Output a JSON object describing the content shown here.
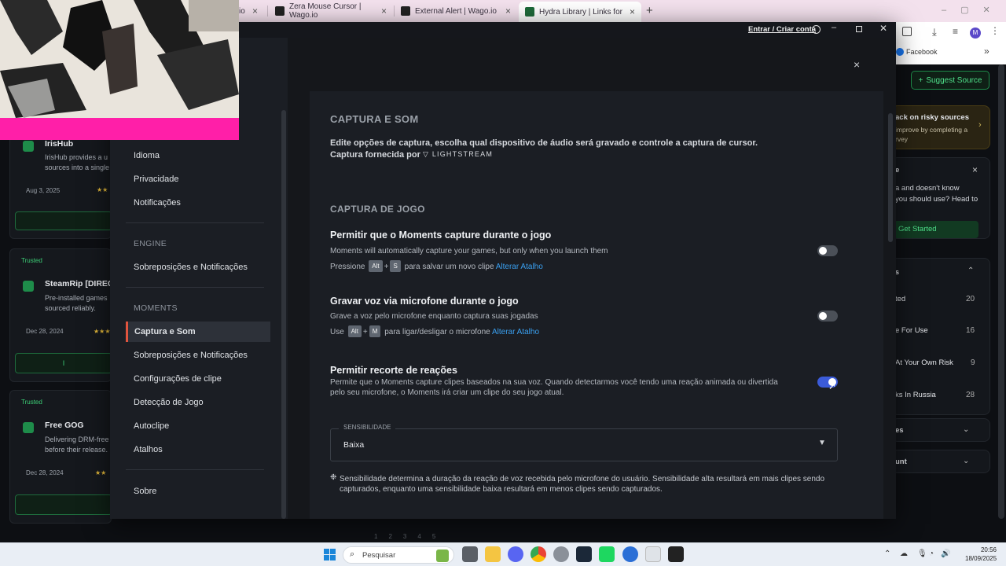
{
  "browser": {
    "tabs": [
      {
        "label": "Zera Mouse Cursor | Wago.io"
      },
      {
        "label": "External Alert | Wago.io"
      },
      {
        "label": "Hydra Library | Links for Hydra L"
      }
    ],
    "partial_tab": "io",
    "bookmark": "Facebook",
    "new_tab": "+",
    "profile_initial": "M"
  },
  "hydra_page": {
    "suggest_button": "Suggest Source",
    "suggest_prefix": "t",
    "risky": {
      "title": "ack on risky sources",
      "body": "improve by completing a\nrvey"
    },
    "help": {
      "title": "e",
      "body": "a and doesn't know\nyou should use? Head to",
      "button": "Get Started"
    },
    "filters": [
      {
        "label": "ted",
        "count": "20"
      },
      {
        "label": "e For Use",
        "count": "16"
      },
      {
        "label": "At Your Own Risk",
        "count": "9"
      },
      {
        "label": "ks In Russia",
        "count": "28"
      }
    ],
    "collapsed": [
      {
        "label": "es"
      },
      {
        "label": "unt"
      }
    ],
    "cards": [
      {
        "badge": "",
        "name": "IrisHub",
        "desc": "IrisHub provides a u\nsources into a single",
        "date": "Aug 3, 2025",
        "stars": "★★"
      },
      {
        "badge": "Trusted",
        "name": "SteamRip [DIREC",
        "desc": "Pre-installed games\nsourced reliably.",
        "date": "Dec 28, 2024",
        "stars": "★★★",
        "action": "I"
      },
      {
        "badge": "Trusted",
        "name": "Free GOG",
        "desc": "Delivering DRM-free\nbefore their release.",
        "date": "Dec 28, 2024",
        "stars": "★★"
      }
    ],
    "pagination": [
      "1",
      "2",
      "3",
      "4",
      "5"
    ]
  },
  "app": {
    "account_link": "Entrar / Criar conta",
    "sidebar": {
      "items_top": [
        "Idioma",
        "Privacidade",
        "Notificações"
      ],
      "engine_header": "ENGINE",
      "engine_items": [
        "Sobreposições e Notificações"
      ],
      "moments_header": "MOMENTS",
      "moments_items": [
        "Captura e Som",
        "Sobreposições e Notificações",
        "Configurações de clipe",
        "Detecção de Jogo",
        "Autoclipe",
        "Atalhos"
      ],
      "about": "Sobre"
    },
    "main": {
      "title": "CAPTURA E SOM",
      "intro": "Edite opções de captura, escolha qual dispositivo de áudio será gravado e controle a captura de cursor.",
      "provided_by": "Captura fornecida por",
      "provider": "LIGHTSTREAM",
      "section": "CAPTURA DE JOGO",
      "options": [
        {
          "title": "Permitir que o Moments capture durante o jogo",
          "desc": "Moments will automatically capture your games, but only when you launch them",
          "hint_pre": "Pressione",
          "key1": "Alt",
          "plus": "+",
          "key2": "S",
          "hint_post": "para salvar um novo clipe",
          "link": "Alterar Atalho",
          "enabled": false
        },
        {
          "title": "Gravar voz via microfone durante o jogo",
          "desc": "Grave a voz pelo microfone enquanto captura suas jogadas",
          "hint_pre": "Use",
          "key1": "Alt",
          "plus": "+",
          "key2": "M",
          "hint_post": "para ligar/desligar o microfone",
          "link": "Alterar Atalho",
          "enabled": false
        },
        {
          "title": "Permitir recorte de reações",
          "desc": "Permite que o Moments capture clipes baseados na sua voz. Quando detectarmos você tendo uma reação animada ou divertida pelo seu microfone, o Moments irá criar um clipe do seu jogo atual.",
          "enabled": true
        }
      ],
      "sensitivity_label": "SENSIBILIDADE",
      "sensitivity_value": "Baixa",
      "sensitivity_note": "Sensibilidade determina a duração da reação de voz recebida pelo microfone do usuário. Sensibilidade alta resultará em mais clipes sendo capturados, enquanto uma sensibilidade baixa resultará em menos clipes sendo capturados."
    }
  },
  "taskbar": {
    "search_placeholder": "Pesquisar",
    "time": "20:56",
    "date": "18/09/2025"
  },
  "colors": {
    "accent_toggle": "#3b5bd9",
    "active_marker": "#e0543e",
    "link": "#3aa0f0",
    "hydra_green": "#1ed760"
  }
}
